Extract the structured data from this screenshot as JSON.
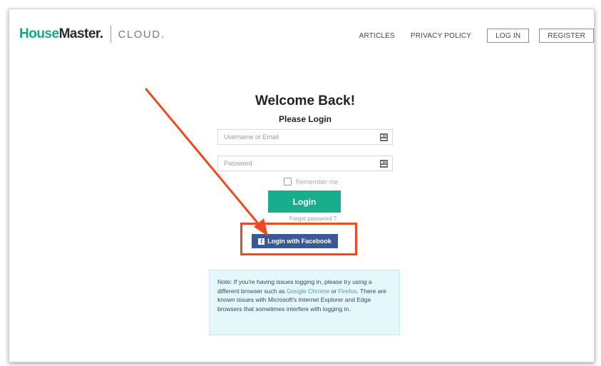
{
  "header": {
    "logo_house": "House",
    "logo_master": "Master.",
    "logo_cloud": "CLOUD.",
    "nav": {
      "articles": "ARTICLES",
      "privacy_policy": "PRIVACY POLICY",
      "log_in": "LOG IN",
      "register": "REGISTER"
    }
  },
  "login": {
    "title": "Welcome Back!",
    "subtitle": "Please Login",
    "username_placeholder": "Username or Email",
    "password_placeholder": "Password",
    "remember_label": "Remember me",
    "login_button": "Login",
    "forgot_link": "Forgot password ?",
    "facebook_button": "Login with Facebook"
  },
  "note": {
    "part1": "Note: If you're having issues logging in, please try using a different browser such as ",
    "link_chrome": "Google Chrome",
    "part2": " or ",
    "link_firefox": "Firefox",
    "part3": ". There are known issues with Microsoft's Internet Explorer and Edge browsers that sometimes interfere with logging in."
  },
  "colors": {
    "brand_green": "#18ad8c",
    "facebook_blue": "#3b5997",
    "annotation_orange": "#ee4a22",
    "note_bg": "#e5f7fb"
  },
  "icons": {
    "field_icon": "field-card-icon",
    "facebook": "facebook-icon",
    "annotation": "arrow-annotation"
  }
}
